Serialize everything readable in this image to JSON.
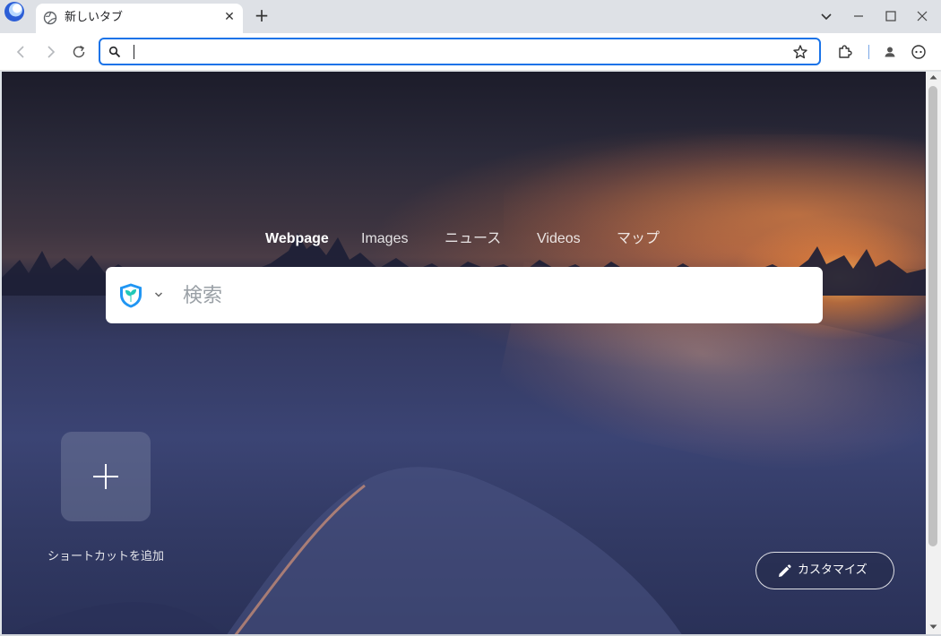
{
  "browser": {
    "tab": {
      "title": "新しいタブ",
      "close_glyph": "✕"
    },
    "new_tab_glyph": "+",
    "omnibox": {
      "value": "",
      "placeholder": ""
    }
  },
  "newtab": {
    "search_tabs": [
      "Webpage",
      "Images",
      "ニュース",
      "Videos",
      "マップ"
    ],
    "active_search_tab": "Webpage",
    "search": {
      "placeholder": "検索"
    },
    "shortcut_add_label": "ショートカットを追加",
    "customize_label": "カスタマイズ"
  },
  "colors": {
    "accent": "#1a73e8",
    "engine_shield": "#2196f3",
    "engine_leaf": "#21c8b6"
  },
  "icons": {
    "tab_favicon": "globe-icon",
    "omnibox": "search-icon",
    "bookmark": "star-icon",
    "extensions": "puzzle-icon",
    "profile": "profile-icon",
    "menu": "smiley-menu-icon",
    "engine": "shield-leaf-icon",
    "customize": "pencil-icon"
  }
}
